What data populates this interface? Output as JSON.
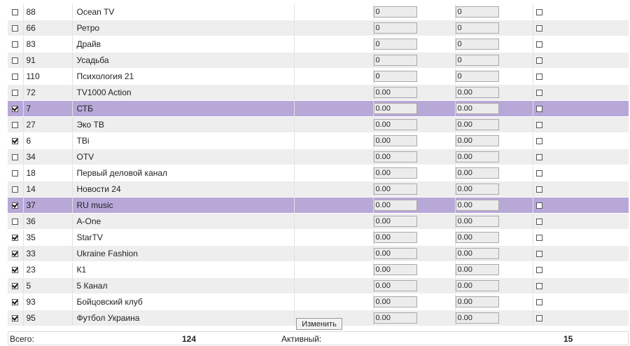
{
  "channels": [
    {
      "checked": false,
      "id": "88",
      "name": "Ocean TV",
      "v1": "0",
      "v2": "0",
      "flag": false
    },
    {
      "checked": false,
      "id": "66",
      "name": "Ретро",
      "v1": "0",
      "v2": "0",
      "flag": false
    },
    {
      "checked": false,
      "id": "83",
      "name": "Драйв",
      "v1": "0",
      "v2": "0",
      "flag": false
    },
    {
      "checked": false,
      "id": "91",
      "name": "Усадьба",
      "v1": "0",
      "v2": "0",
      "flag": false
    },
    {
      "checked": false,
      "id": "110",
      "name": "Психология 21",
      "v1": "0",
      "v2": "0",
      "flag": false
    },
    {
      "checked": false,
      "id": "72",
      "name": "TV1000 Action",
      "v1": "0.00",
      "v2": "0.00",
      "flag": false
    },
    {
      "checked": true,
      "id": "7",
      "name": "СТБ",
      "v1": "0.00",
      "v2": "0.00",
      "flag": false,
      "highlight": true
    },
    {
      "checked": false,
      "id": "27",
      "name": "Эко ТВ",
      "v1": "0.00",
      "v2": "0.00",
      "flag": false
    },
    {
      "checked": true,
      "id": "6",
      "name": "ТВі",
      "v1": "0.00",
      "v2": "0.00",
      "flag": false
    },
    {
      "checked": false,
      "id": "34",
      "name": "OTV",
      "v1": "0.00",
      "v2": "0.00",
      "flag": false
    },
    {
      "checked": false,
      "id": "18",
      "name": "Первый деловой канал",
      "v1": "0.00",
      "v2": "0.00",
      "flag": false
    },
    {
      "checked": false,
      "id": "14",
      "name": "Новости 24",
      "v1": "0.00",
      "v2": "0.00",
      "flag": false
    },
    {
      "checked": true,
      "id": "37",
      "name": "RU music",
      "v1": "0.00",
      "v2": "0.00",
      "flag": false,
      "highlight": true
    },
    {
      "checked": false,
      "id": "36",
      "name": "A-One",
      "v1": "0.00",
      "v2": "0.00",
      "flag": false
    },
    {
      "checked": true,
      "id": "35",
      "name": "StarTV",
      "v1": "0.00",
      "v2": "0.00",
      "flag": false
    },
    {
      "checked": true,
      "id": "33",
      "name": "Ukraine Fashion",
      "v1": "0.00",
      "v2": "0.00",
      "flag": false
    },
    {
      "checked": true,
      "id": "23",
      "name": "К1",
      "v1": "0.00",
      "v2": "0.00",
      "flag": false
    },
    {
      "checked": true,
      "id": "5",
      "name": "5 Канал",
      "v1": "0.00",
      "v2": "0.00",
      "flag": false
    },
    {
      "checked": true,
      "id": "93",
      "name": "Бойцовский клуб",
      "v1": "0.00",
      "v2": "0.00",
      "flag": false
    },
    {
      "checked": true,
      "id": "95",
      "name": "Футбол Украина",
      "v1": "0.00",
      "v2": "0.00",
      "flag": false
    }
  ],
  "update_button_label": "Изменить",
  "footer": {
    "total_label": "Всего:",
    "total_value": "124",
    "active_label": "Активный:",
    "active_value": "15"
  }
}
